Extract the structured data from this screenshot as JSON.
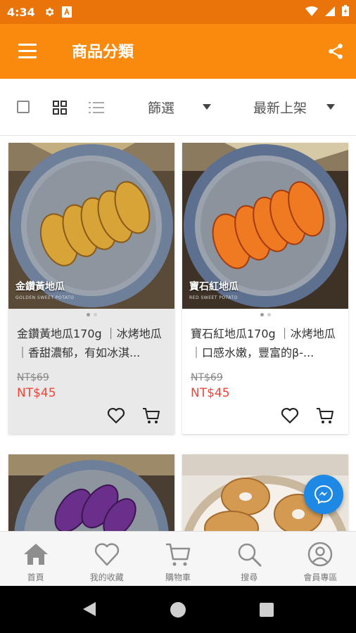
{
  "status_bar": {
    "time": "4:34"
  },
  "app_bar": {
    "title": "商品分類"
  },
  "toolbar": {
    "filter_label": "篩選",
    "sort_label": "最新上架"
  },
  "products": [
    {
      "name": "金鑽黃地瓜170g ｜冰烤地瓜｜香甜濃郁，有如冰淇...",
      "image_caption": "金鑽黃地瓜",
      "image_subcaption": "GOLDEN SWEET POTATO",
      "old_price": "NT$69",
      "price": "NT$45"
    },
    {
      "name": "寶石紅地瓜170g ｜冰烤地瓜｜口感水嫩，豐富的β-...",
      "image_caption": "寶石紅地瓜",
      "image_subcaption": "RED SWEET POTATO",
      "old_price": "NT$69",
      "price": "NT$45"
    }
  ],
  "bottom_nav": [
    {
      "label": "首頁",
      "icon": "home-icon"
    },
    {
      "label": "我的收藏",
      "icon": "heart-icon"
    },
    {
      "label": "購物車",
      "icon": "cart-icon"
    },
    {
      "label": "搜尋",
      "icon": "search-icon"
    },
    {
      "label": "會員專區",
      "icon": "user-icon"
    }
  ],
  "colors": {
    "app_bar": "#f98a0e",
    "status_bar": "#e8740a",
    "price": "#f44336",
    "messenger": "#1e88e5"
  }
}
